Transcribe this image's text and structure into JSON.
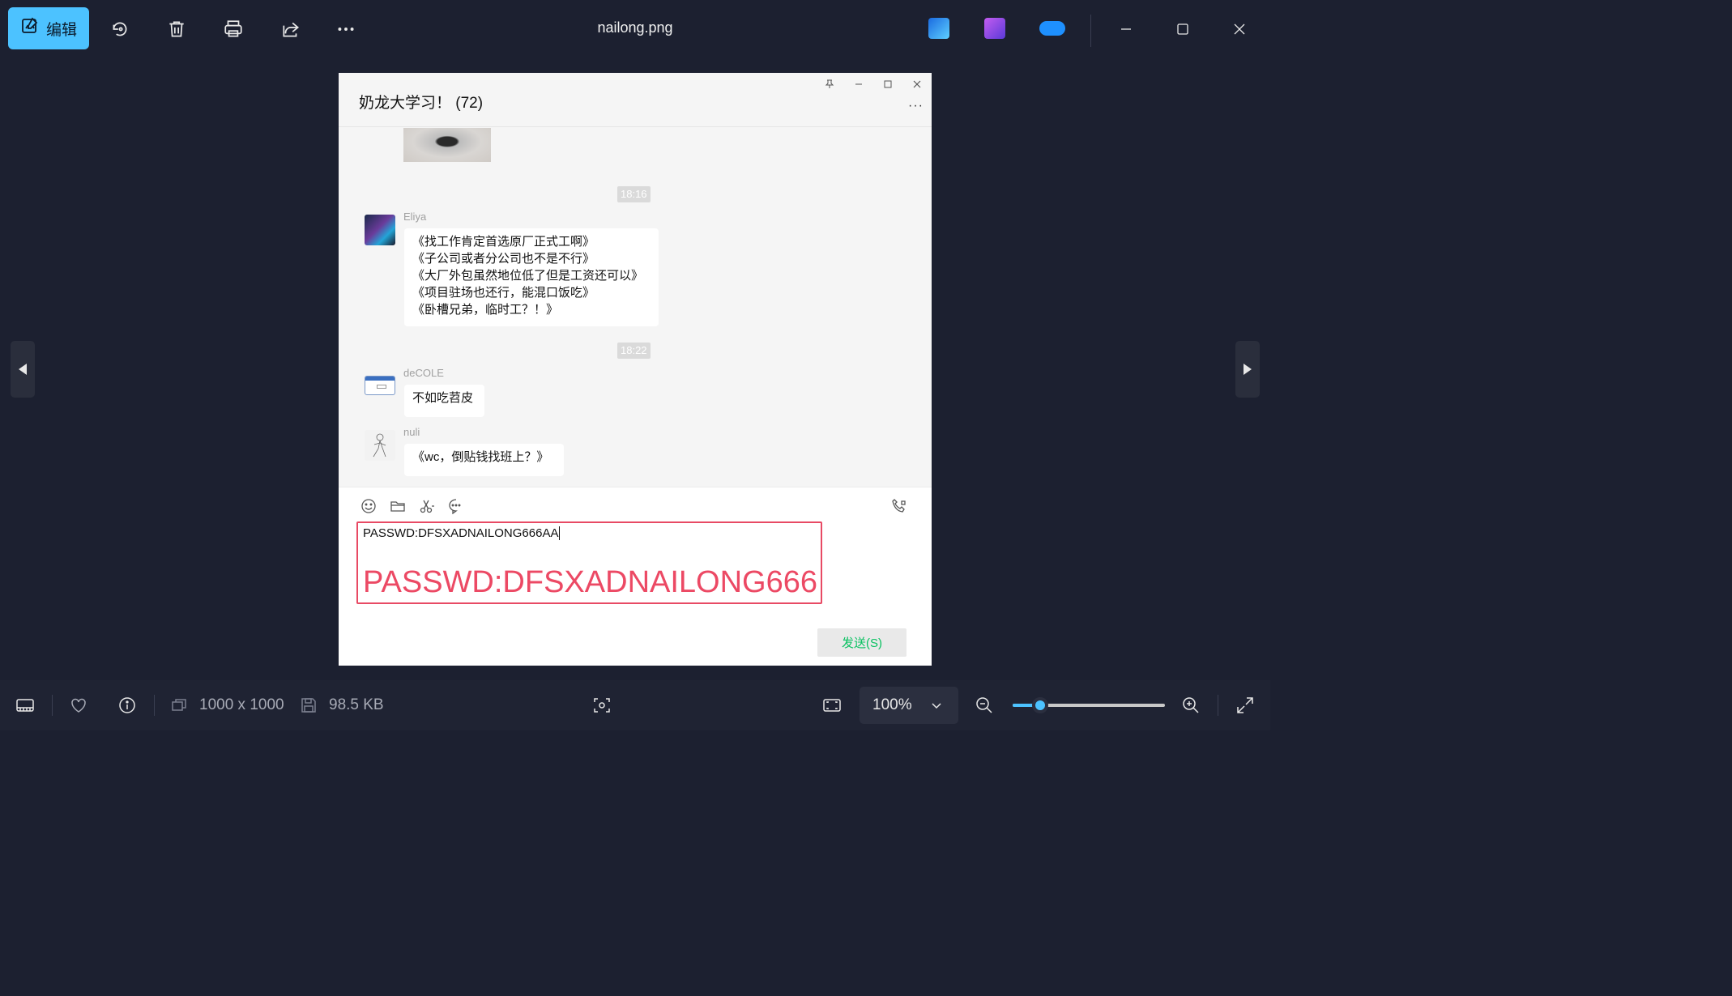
{
  "toolbar": {
    "edit_label": "编辑",
    "file_title": "nailong.png"
  },
  "chat": {
    "title": "奶龙大学习！ (72)",
    "more": "···",
    "messages": [
      {
        "time": "18:16",
        "sender": "Eliya",
        "lines": [
          "《找工作肯定首选原厂正式工啊》",
          "《子公司或者分公司也不是不行》",
          "《大厂外包虽然地位低了但是工资还可以》",
          "《项目驻场也还行，能混口饭吃》",
          "《卧槽兄弟，临时工？！》"
        ]
      },
      {
        "time": "18:22",
        "sender": "deCOLE",
        "lines": [
          "不如吃苕皮"
        ]
      },
      {
        "time": "",
        "sender": "nuli",
        "lines": [
          "《wc，倒贴钱找班上？》"
        ]
      }
    ],
    "input_text": "PASSWD:DFSXADNAILONG666AA",
    "overlay_text": "PASSWD:DFSXADNAILONG666",
    "send_label": "发送(S)"
  },
  "statusbar": {
    "dimensions": "1000 x 1000",
    "file_size": "98.5 KB",
    "zoom": "100%",
    "zoom_level": 0.18
  },
  "colors": {
    "accent": "#4cc2ff",
    "highlight_red": "#ec4964",
    "wechat_green": "#07c160"
  },
  "icons": [
    "edit-icon",
    "rotate-icon",
    "delete-icon",
    "print-icon",
    "share-icon",
    "more-icon",
    "clipchamp-icon",
    "video-editor-icon",
    "onedrive-icon",
    "minimize-icon",
    "maximize-icon",
    "close-icon",
    "previous-icon",
    "next-icon",
    "filmstrip-icon",
    "favorite-icon",
    "info-icon",
    "dimensions-icon",
    "filesize-icon",
    "visual-search-icon",
    "fit-window-icon",
    "zoom-out-icon",
    "zoom-in-icon",
    "fullscreen-icon"
  ]
}
